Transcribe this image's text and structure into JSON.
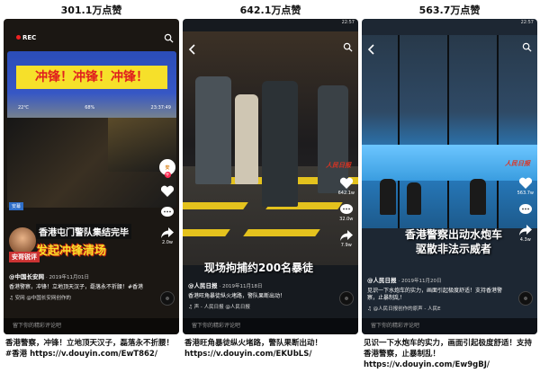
{
  "panels": [
    {
      "likes": "301.1万点赞",
      "rec_label": "REC",
      "headline": "冲锋！冲锋！冲锋！",
      "weather": [
        "22℃",
        "68%",
        "23:37:49"
      ],
      "corner_badge": "安幕",
      "banner_top": "香港屯门警队集结完毕",
      "banner_bottom": "发起冲锋清场",
      "anchor_tag": "安哥锐评",
      "rail": {
        "likes": "",
        "comments": "",
        "shares": "2.0w"
      },
      "author": "@中国长安网",
      "date": "· 2019年11月01日",
      "desc": "香港警察，冲锋！立地顶天汉子，磊落永不折腰！#香港",
      "music": "♫ 安网  @中国长安网创作的",
      "comment_placeholder": "留下你的精彩评论吧",
      "caption": "香港警察，冲锋！立地顶天汉子，磊落永不折腰！#香港 https://v.douyin.com/EwT862/"
    },
    {
      "likes": "642.1万点赞",
      "status_time": "22:57",
      "sign": "",
      "overlay": "现场拘捕约200名暴徒",
      "watermark": "人民日报",
      "rail": {
        "likes": "642.1w",
        "comments": "32.0w",
        "shares": "7.9w"
      },
      "author": "@人民日报",
      "date": "· 2019年11月18日",
      "desc": "香港旺角暴徒纵火堵路，警队果断出动！",
      "music": "♫ 声 - 人民日报  @人民日报",
      "comment_placeholder": "留下你的精彩评论吧",
      "caption": "香港旺角暴徒纵火堵路，警队果断出动！ https://v.douyin.com/EKUbLS/"
    },
    {
      "likes": "563.7万点赞",
      "status_time": "22:57",
      "overlay_line1": "香港警察出动水炮车",
      "overlay_line2": "驱散非法示威者",
      "watermark": "人民日报",
      "rail": {
        "likes": "563.7w",
        "comments": "",
        "shares": "4.3w"
      },
      "author": "@人民日报",
      "date": "· 2019年11月20日",
      "desc": "见识一下水炮车的实力，画面引起极度舒适！支持香港警察，止暴制乱！",
      "music": "♫ @人民日报创作的原声 - 人民E",
      "comment_placeholder": "留下你的精彩评论吧",
      "caption": "见识一下水炮车的实力，画面引起极度舒适！支持香港警察，止暴制乱！ https://v.douyin.com/Ew9gBJ/"
    }
  ],
  "colors": {
    "accent_red": "#fe2c55",
    "banner_yellow": "#f6e02a",
    "stripe_yellow": "#e4c21d"
  },
  "icons": [
    "back-icon",
    "search-icon",
    "heart-icon",
    "comment-icon",
    "share-icon",
    "music-disc-icon"
  ]
}
